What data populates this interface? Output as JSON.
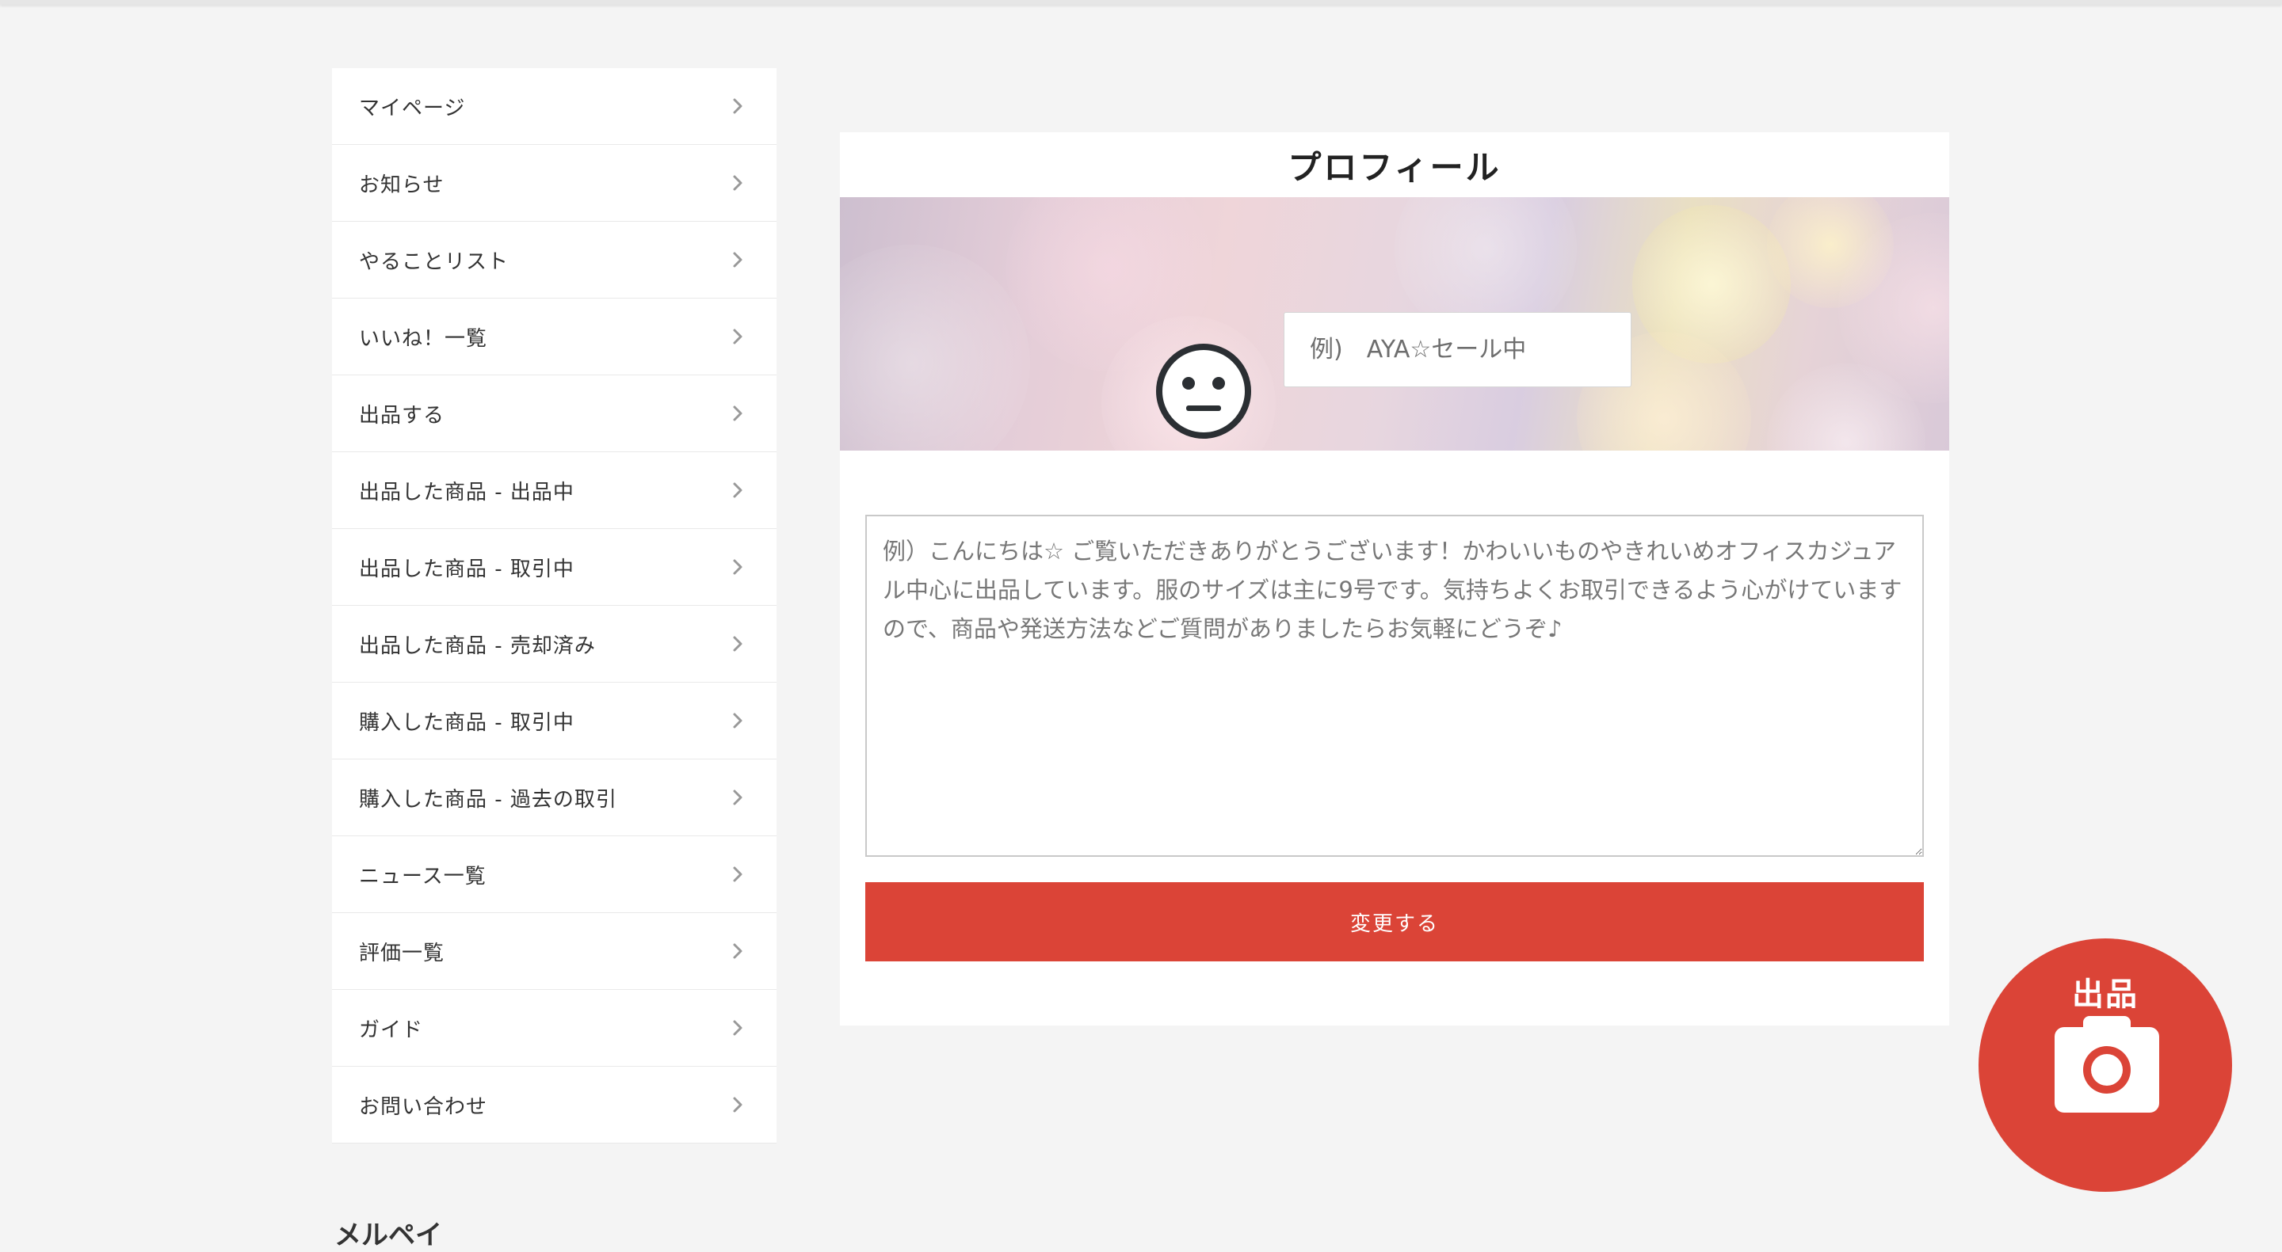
{
  "sidebar": {
    "items": [
      {
        "label": "マイページ"
      },
      {
        "label": "お知らせ"
      },
      {
        "label": "やることリスト"
      },
      {
        "label": "いいね！一覧"
      },
      {
        "label": "出品する"
      },
      {
        "label": "出品した商品 - 出品中"
      },
      {
        "label": "出品した商品 - 取引中"
      },
      {
        "label": "出品した商品 - 売却済み"
      },
      {
        "label": "購入した商品 - 取引中"
      },
      {
        "label": "購入した商品 - 過去の取引"
      },
      {
        "label": "ニュース一覧"
      },
      {
        "label": "評価一覧"
      },
      {
        "label": "ガイド"
      },
      {
        "label": "お問い合わせ"
      }
    ],
    "section_title": "メルペイ"
  },
  "profile": {
    "title": "プロフィール",
    "avatar_icon": "neutral-face-icon",
    "nickname_placeholder": "例)　AYA☆セール中",
    "bio_placeholder": "例）こんにちは☆ ご覧いただきありがとうございます！かわいいものやきれいめオフィスカジュアル中心に出品しています。服のサイズは主に9号です。気持ちよくお取引できるよう心がけていますので、商品や発送方法などご質問がありましたらお気軽にどうぞ♪",
    "submit_label": "変更する"
  },
  "fab": {
    "label": "出品",
    "icon": "camera-icon"
  },
  "colors": {
    "accent": "#db4437",
    "background": "#f4f4f4"
  }
}
